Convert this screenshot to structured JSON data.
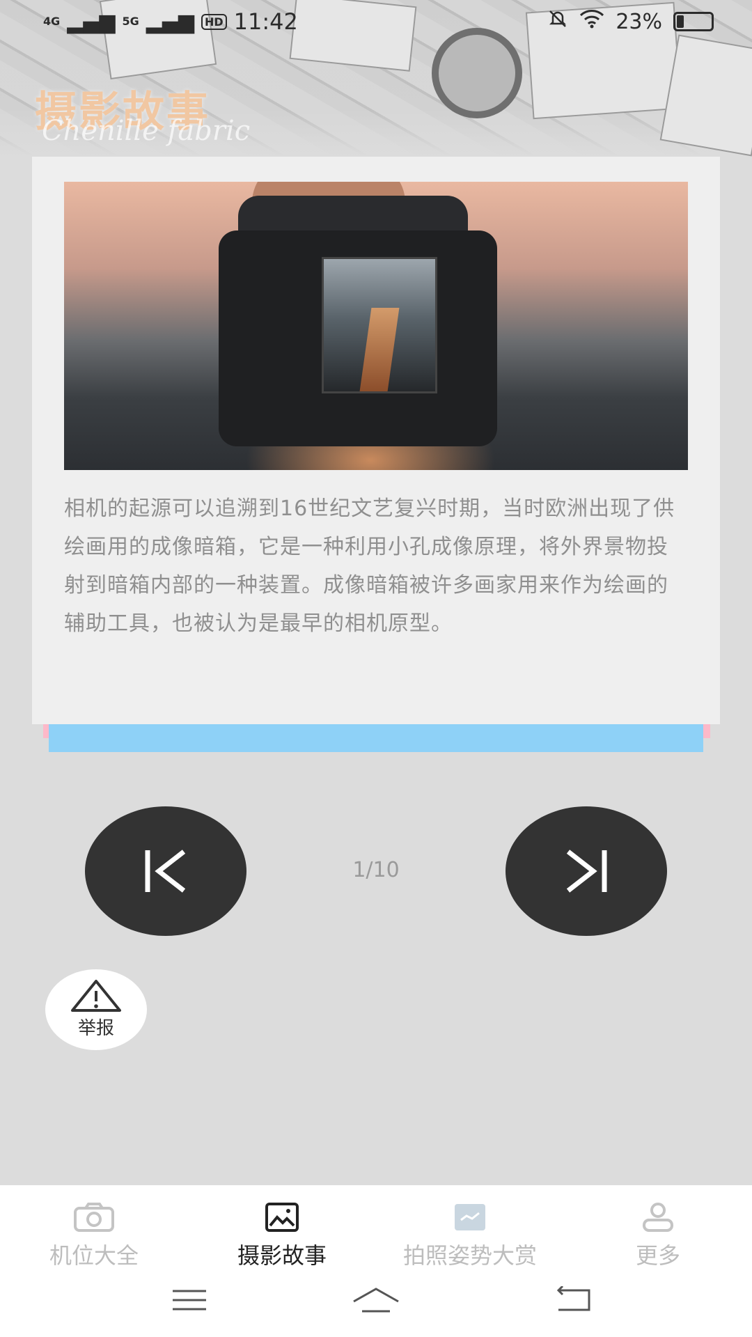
{
  "status_bar": {
    "signal_1": "4G",
    "signal_2": "5G",
    "hd": "HD",
    "time": "11:42",
    "battery": "23%"
  },
  "header": {
    "title": "摄影故事",
    "subtitle": "Chenille fabric"
  },
  "article": {
    "body": "相机的起源可以追溯到16世纪文艺复兴时期，当时欧洲出现了供绘画用的成像暗箱，它是一种利用小孔成像原理，将外界景物投射到暗箱内部的一种装置。成像暗箱被许多画家用来作为绘画的辅助工具，也被认为是最早的相机原型。"
  },
  "pager": {
    "indicator": "1/10"
  },
  "report": {
    "label": "举报"
  },
  "tabs": [
    {
      "label": "机位大全",
      "icon": "camera-icon",
      "active": false
    },
    {
      "label": "摄影故事",
      "icon": "image-icon",
      "active": true
    },
    {
      "label": "拍照姿势大赏",
      "icon": "picture-icon",
      "active": false
    },
    {
      "label": "更多",
      "icon": "user-icon",
      "active": false
    }
  ],
  "colors": {
    "card_bg": "#efefef",
    "button_bg": "#333333",
    "accent_pink": "#fdb9c9",
    "accent_blue": "#8ed1f7",
    "title_color": "#f1c7a2"
  }
}
